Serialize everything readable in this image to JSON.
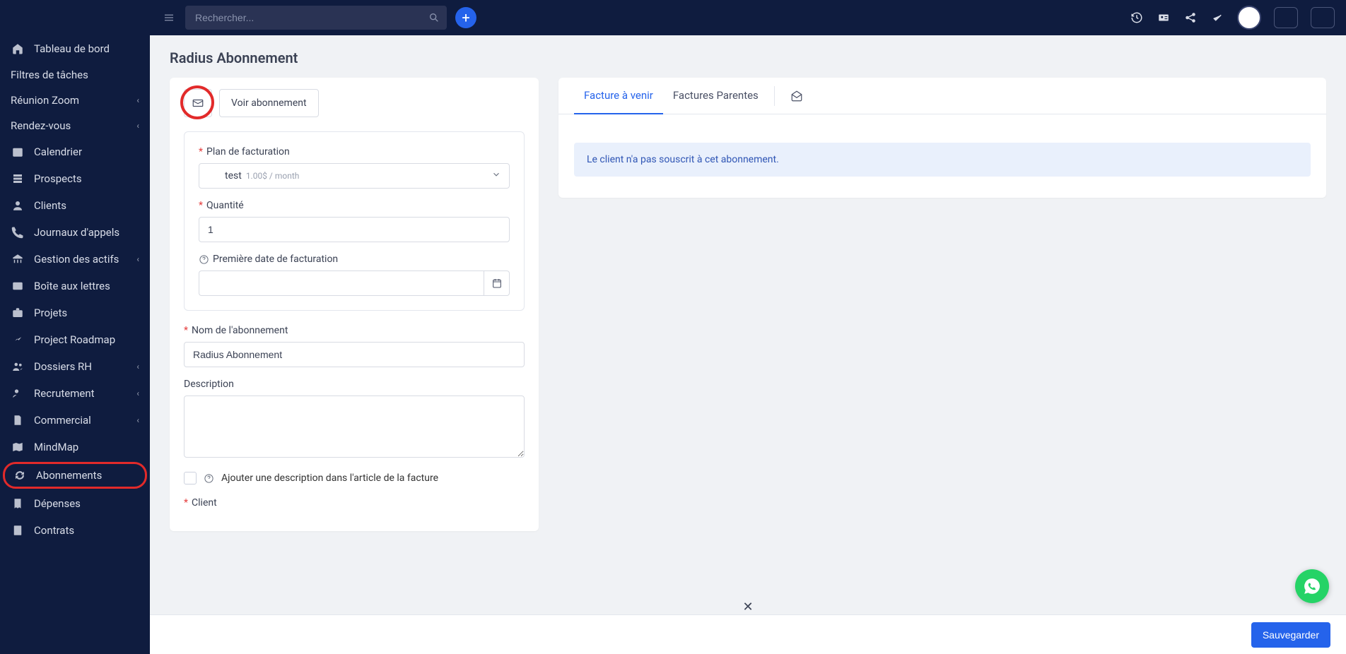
{
  "header": {
    "search_placeholder": "Rechercher..."
  },
  "sidebar": {
    "items": [
      {
        "label": "Tableau de bord",
        "icon": "home",
        "chevron": false
      },
      {
        "label": "Filtres de tâches",
        "icon": "",
        "chevron": false
      },
      {
        "label": "Réunion Zoom",
        "icon": "",
        "chevron": true
      },
      {
        "label": "Rendez-vous",
        "icon": "",
        "chevron": true
      },
      {
        "label": "Calendrier",
        "icon": "calendar",
        "chevron": false
      },
      {
        "label": "Prospects",
        "icon": "stack",
        "chevron": false
      },
      {
        "label": "Clients",
        "icon": "user",
        "chevron": false
      },
      {
        "label": "Journaux d'appels",
        "icon": "phone",
        "chevron": false
      },
      {
        "label": "Gestion des actifs",
        "icon": "bank",
        "chevron": true
      },
      {
        "label": "Boîte aux lettres",
        "icon": "mail",
        "chevron": false
      },
      {
        "label": "Projets",
        "icon": "briefcase",
        "chevron": false
      },
      {
        "label": "Project Roadmap",
        "icon": "chart",
        "chevron": false
      },
      {
        "label": "Dossiers RH",
        "icon": "users",
        "chevron": true
      },
      {
        "label": "Recrutement",
        "icon": "user-plus",
        "chevron": true
      },
      {
        "label": "Commercial",
        "icon": "file",
        "chevron": true
      },
      {
        "label": "MindMap",
        "icon": "map",
        "chevron": false
      },
      {
        "label": "Abonnements",
        "icon": "sync",
        "chevron": false,
        "highlighted": true
      },
      {
        "label": "Dépenses",
        "icon": "receipt",
        "chevron": false
      },
      {
        "label": "Contrats",
        "icon": "contract",
        "chevron": false
      }
    ]
  },
  "page": {
    "title": "Radius Abonnement"
  },
  "actions": {
    "view_subscription": "Voir abonnement"
  },
  "form": {
    "billing_plan_label": "Plan de facturation",
    "billing_plan_value": "test",
    "billing_plan_sub": "1.00$ / month",
    "quantity_label": "Quantité",
    "quantity_value": "1",
    "first_bill_date_label": "Première date de facturation",
    "first_bill_date_value": "",
    "subscription_name_label": "Nom de l'abonnement",
    "subscription_name_value": "Radius Abonnement",
    "description_label": "Description",
    "description_value": "",
    "add_desc_checkbox_label": "Ajouter une description dans l'article de la facture",
    "client_label": "Client"
  },
  "right_panel": {
    "tab_upcoming": "Facture à venir",
    "tab_parent": "Factures Parentes",
    "alert_text": "Le client n'a pas souscrit à cet abonnement."
  },
  "footer": {
    "save_label": "Sauvegarder"
  }
}
